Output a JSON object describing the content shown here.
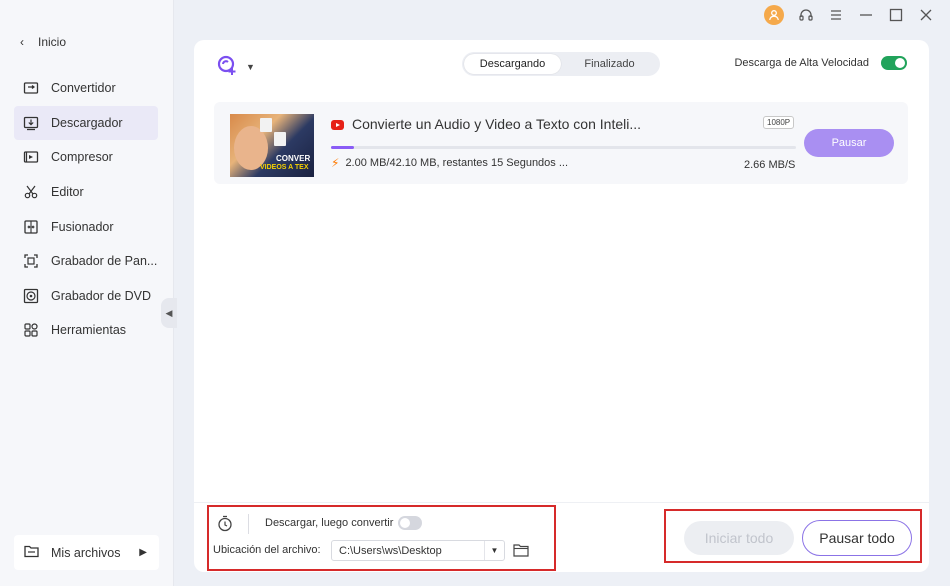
{
  "sidebar": {
    "back_label": "Inicio",
    "items": [
      {
        "label": "Convertidor",
        "icon": "convert-icon",
        "active": false
      },
      {
        "label": "Descargador",
        "icon": "download-icon",
        "active": true
      },
      {
        "label": "Compresor",
        "icon": "compress-icon",
        "active": false
      },
      {
        "label": "Editor",
        "icon": "scissors-icon",
        "active": false
      },
      {
        "label": "Fusionador",
        "icon": "merge-icon",
        "active": false
      },
      {
        "label": "Grabador de Pan...",
        "icon": "screen-record-icon",
        "active": false
      },
      {
        "label": "Grabador de DVD",
        "icon": "dvd-icon",
        "active": false
      },
      {
        "label": "Herramientas",
        "icon": "grid-icon",
        "active": false
      }
    ],
    "my_files": "Mis archivos"
  },
  "tabs": [
    {
      "label": "Descargando",
      "active": true
    },
    {
      "label": "Finalizado",
      "active": false
    }
  ],
  "high_speed": {
    "label": "Descarga de Alta Velocidad",
    "on": true
  },
  "download": {
    "title": "Convierte un Audio y Video a Texto con Inteli...",
    "resolution": "1080P",
    "progress_fraction": 0.05,
    "info": "2.00 MB/42.10 MB, restantes 15 Segundos ...",
    "speed": "2.66 MB/S",
    "pause_label": "Pausar",
    "thumb_text_1": "CONVER",
    "thumb_text_2": "VIDEOS A TEX"
  },
  "bottom": {
    "download_then_convert": "Descargar, luego convertir",
    "convert_on": false,
    "location_label": "Ubicación del archivo:",
    "location_value": "C:\\Users\\ws\\Desktop",
    "start_all": "Iniciar todo",
    "pause_all": "Pausar todo"
  },
  "colors": {
    "accent": "#8a5cf6",
    "toggle_on": "#21a35b",
    "highlight_box": "#d62a2a",
    "youtube": "#e62117"
  }
}
